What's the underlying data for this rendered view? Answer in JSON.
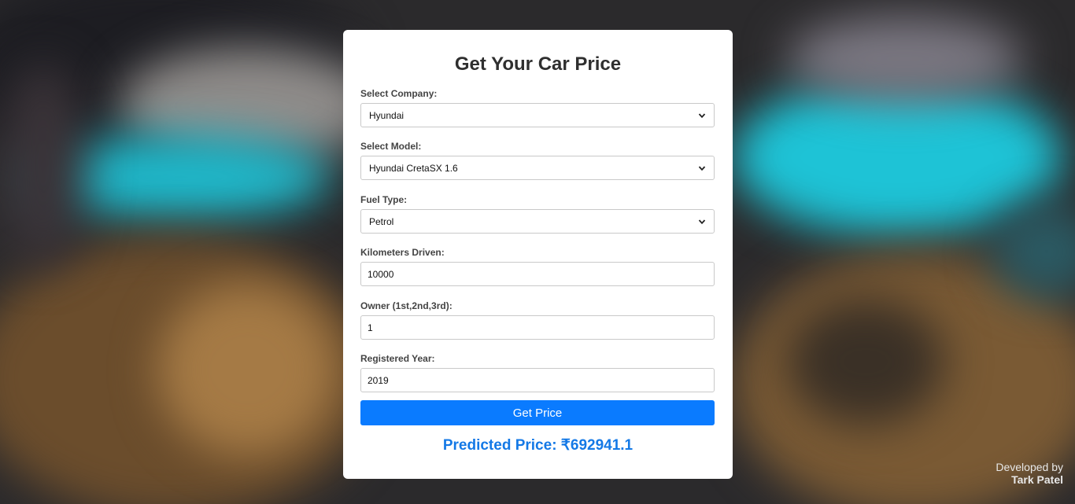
{
  "form": {
    "title": "Get Your Car Price",
    "company": {
      "label": "Select Company:",
      "value": "Hyundai"
    },
    "model": {
      "label": "Select Model:",
      "value": "Hyundai CretaSX 1.6"
    },
    "fuel": {
      "label": "Fuel Type:",
      "value": "Petrol"
    },
    "kms": {
      "label": "Kilometers Driven:",
      "value": "10000"
    },
    "owner": {
      "label": "Owner (1st,2nd,3rd):",
      "value": "1"
    },
    "year": {
      "label": "Registered Year:",
      "value": "2019"
    },
    "submit_label": "Get Price",
    "result": "Predicted Price: ₹692941.1"
  },
  "footer": {
    "developed_by": "Developed by",
    "author": "Tark Patel"
  },
  "colors": {
    "button": "#0a7bff",
    "result": "#1479e6"
  },
  "icons": {
    "select_arrow": "chevron-down-icon"
  }
}
